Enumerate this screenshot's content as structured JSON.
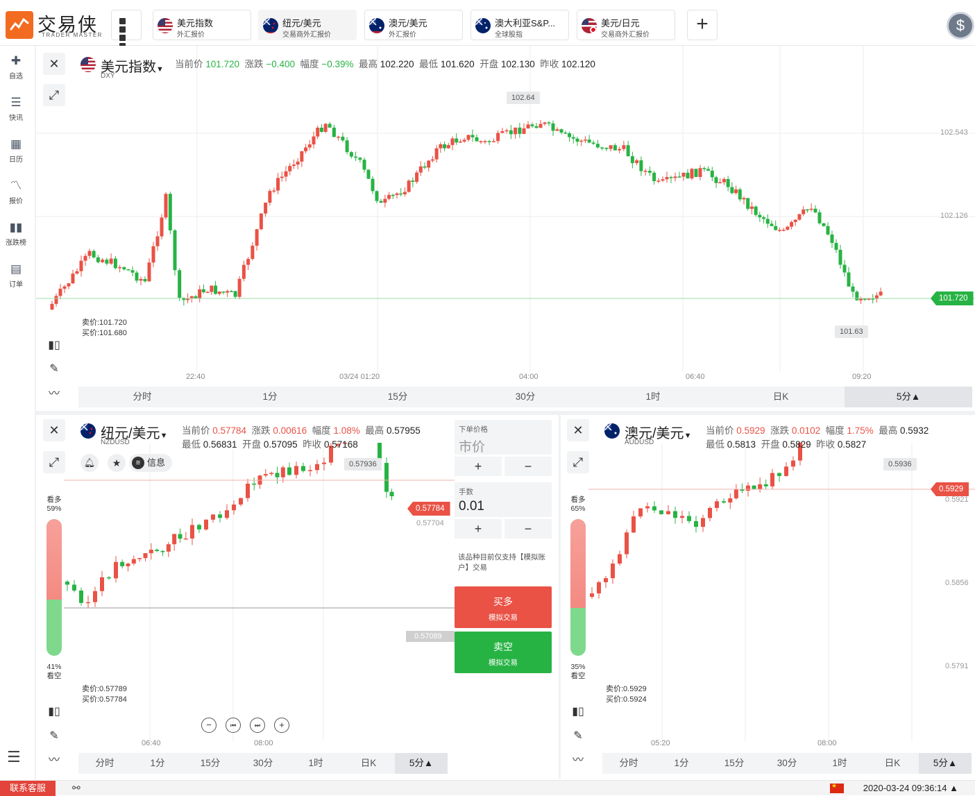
{
  "logo": {
    "name_cn": "交易侠",
    "name_en": "TRADER MASTER"
  },
  "tabs": [
    {
      "title": "美元指数",
      "sub": "外汇报价"
    },
    {
      "title": "纽元/美元",
      "sub": "交易商外汇报价"
    },
    {
      "title": "澳元/美元",
      "sub": "外汇报价"
    },
    {
      "title": "澳大利亚S&P...",
      "sub": "全球股指"
    },
    {
      "title": "美元/日元",
      "sub": "交易商外汇报价"
    }
  ],
  "sidebar": [
    {
      "label": "自选",
      "icon": "add-watchlist-icon"
    },
    {
      "label": "快讯",
      "icon": "news-icon"
    },
    {
      "label": "日历",
      "icon": "calendar-icon"
    },
    {
      "label": "报价",
      "icon": "quote-chart-icon"
    },
    {
      "label": "涨跌榜",
      "icon": "ranking-icon"
    },
    {
      "label": "订单",
      "icon": "order-icon"
    }
  ],
  "timeframes": [
    "分时",
    "1分",
    "15分",
    "30分",
    "1时",
    "日K",
    "5分▲"
  ],
  "main": {
    "name": "美元指数",
    "code": "DXY",
    "quote": {
      "cur_label": "当前价",
      "cur": "101.720",
      "chg_label": "涨跌",
      "chg": "−0.400",
      "pct_label": "幅度",
      "pct": "−0.39%",
      "high_label": "最高",
      "high": "102.220",
      "low_label": "最低",
      "low": "101.620",
      "open_label": "开盘",
      "open": "102.130",
      "prev_label": "昨收",
      "prev": "102.120"
    },
    "bid": "卖价:101.720",
    "ask": "买价:101.680",
    "price_tag": "101.720",
    "max_bubble": "102.64",
    "min_bubble": "101.63",
    "y_ticks": [
      "102.543",
      "102.126"
    ],
    "x_ticks": [
      "22:40",
      "03/24 01:20",
      "04:00",
      "06:40",
      "09:20"
    ]
  },
  "nzd": {
    "name": "纽元/美元",
    "code": "NZDUSD",
    "quote": {
      "cur_label": "当前价",
      "cur": "0.57784",
      "chg_label": "涨跌",
      "chg": "0.00616",
      "pct_label": "幅度",
      "pct": "1.08%",
      "high_label": "最高",
      "high": "0.57955",
      "low_label": "最低",
      "low": "0.56831",
      "open_label": "开盘",
      "open": "0.57095",
      "prev_label": "昨收",
      "prev": "0.57168"
    },
    "info_label": "信息",
    "long_label": "看多",
    "long_pct": "59%",
    "short_label": "看空",
    "short_pct": "41%",
    "bid": "卖价:0.57789",
    "ask": "买价:0.57784",
    "price_tag": "0.57784",
    "price_tag2": "0.57704",
    "price_tag3": "0.57089",
    "max_bubble": "0.57936",
    "x_ticks": [
      "06:40",
      "08:00"
    ],
    "order": {
      "price_label": "下单价格",
      "price_value": "市价",
      "lot_label": "手数",
      "lot_value": "0.01",
      "plus": "+",
      "minus": "−",
      "notice": "该品种目前仅支持【模拟账户】交易",
      "buy": "买多",
      "buy_sub": "模拟交易",
      "sell": "卖空",
      "sell_sub": "模拟交易"
    }
  },
  "aud": {
    "name": "澳元/美元",
    "code": "AUDUSD",
    "quote": {
      "cur_label": "当前价",
      "cur": "0.5929",
      "chg_label": "涨跌",
      "chg": "0.0102",
      "pct_label": "幅度",
      "pct": "1.75%",
      "high_label": "最高",
      "high": "0.5932",
      "low_label": "最低",
      "low": "0.5813",
      "open_label": "开盘",
      "open": "0.5829",
      "prev_label": "昨收",
      "prev": "0.5827"
    },
    "long_label": "看多",
    "long_pct": "65%",
    "short_label": "看空",
    "short_pct": "35%",
    "bid": "卖价:0.5929",
    "ask": "买价:0.5924",
    "price_tag": "0.5929",
    "max_bubble": "0.5936",
    "y_ticks": [
      "0.5921",
      "0.5856",
      "0.5791"
    ],
    "x_ticks": [
      "05:20",
      "08:00"
    ]
  },
  "status": {
    "service": "联系客服",
    "clock": "2020-03-24 09:36:14 ▲"
  },
  "colors": {
    "up": "#e95245",
    "down": "#27b344",
    "brand": "#f26b21"
  }
}
